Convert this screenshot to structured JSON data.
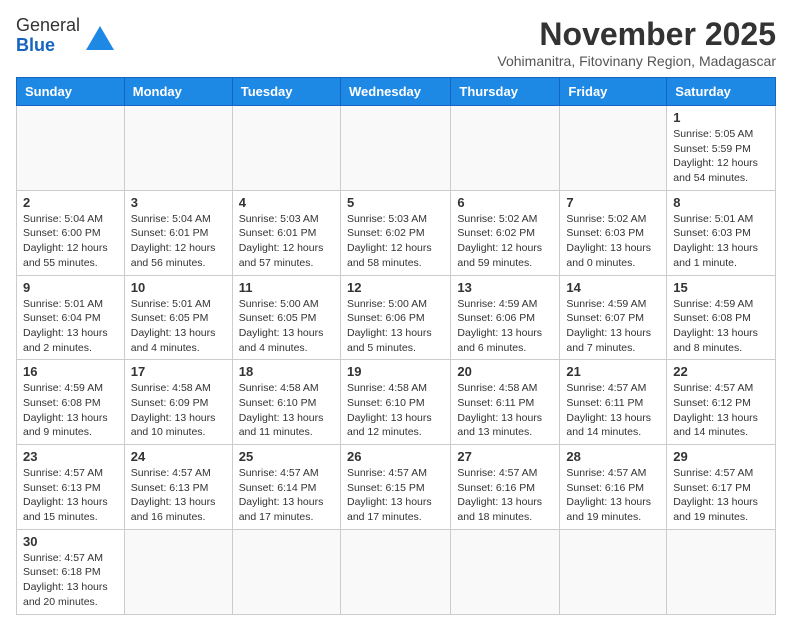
{
  "logo": {
    "general": "General",
    "blue": "Blue"
  },
  "title": "November 2025",
  "location": "Vohimanitra, Fitovinany Region, Madagascar",
  "days_header": [
    "Sunday",
    "Monday",
    "Tuesday",
    "Wednesday",
    "Thursday",
    "Friday",
    "Saturday"
  ],
  "weeks": [
    [
      {
        "day": "",
        "info": ""
      },
      {
        "day": "",
        "info": ""
      },
      {
        "day": "",
        "info": ""
      },
      {
        "day": "",
        "info": ""
      },
      {
        "day": "",
        "info": ""
      },
      {
        "day": "",
        "info": ""
      },
      {
        "day": "1",
        "info": "Sunrise: 5:05 AM\nSunset: 5:59 PM\nDaylight: 12 hours and 54 minutes."
      }
    ],
    [
      {
        "day": "2",
        "info": "Sunrise: 5:04 AM\nSunset: 6:00 PM\nDaylight: 12 hours and 55 minutes."
      },
      {
        "day": "3",
        "info": "Sunrise: 5:04 AM\nSunset: 6:01 PM\nDaylight: 12 hours and 56 minutes."
      },
      {
        "day": "4",
        "info": "Sunrise: 5:03 AM\nSunset: 6:01 PM\nDaylight: 12 hours and 57 minutes."
      },
      {
        "day": "5",
        "info": "Sunrise: 5:03 AM\nSunset: 6:02 PM\nDaylight: 12 hours and 58 minutes."
      },
      {
        "day": "6",
        "info": "Sunrise: 5:02 AM\nSunset: 6:02 PM\nDaylight: 12 hours and 59 minutes."
      },
      {
        "day": "7",
        "info": "Sunrise: 5:02 AM\nSunset: 6:03 PM\nDaylight: 13 hours and 0 minutes."
      },
      {
        "day": "8",
        "info": "Sunrise: 5:01 AM\nSunset: 6:03 PM\nDaylight: 13 hours and 1 minute."
      }
    ],
    [
      {
        "day": "9",
        "info": "Sunrise: 5:01 AM\nSunset: 6:04 PM\nDaylight: 13 hours and 2 minutes."
      },
      {
        "day": "10",
        "info": "Sunrise: 5:01 AM\nSunset: 6:05 PM\nDaylight: 13 hours and 4 minutes."
      },
      {
        "day": "11",
        "info": "Sunrise: 5:00 AM\nSunset: 6:05 PM\nDaylight: 13 hours and 4 minutes."
      },
      {
        "day": "12",
        "info": "Sunrise: 5:00 AM\nSunset: 6:06 PM\nDaylight: 13 hours and 5 minutes."
      },
      {
        "day": "13",
        "info": "Sunrise: 4:59 AM\nSunset: 6:06 PM\nDaylight: 13 hours and 6 minutes."
      },
      {
        "day": "14",
        "info": "Sunrise: 4:59 AM\nSunset: 6:07 PM\nDaylight: 13 hours and 7 minutes."
      },
      {
        "day": "15",
        "info": "Sunrise: 4:59 AM\nSunset: 6:08 PM\nDaylight: 13 hours and 8 minutes."
      }
    ],
    [
      {
        "day": "16",
        "info": "Sunrise: 4:59 AM\nSunset: 6:08 PM\nDaylight: 13 hours and 9 minutes."
      },
      {
        "day": "17",
        "info": "Sunrise: 4:58 AM\nSunset: 6:09 PM\nDaylight: 13 hours and 10 minutes."
      },
      {
        "day": "18",
        "info": "Sunrise: 4:58 AM\nSunset: 6:10 PM\nDaylight: 13 hours and 11 minutes."
      },
      {
        "day": "19",
        "info": "Sunrise: 4:58 AM\nSunset: 6:10 PM\nDaylight: 13 hours and 12 minutes."
      },
      {
        "day": "20",
        "info": "Sunrise: 4:58 AM\nSunset: 6:11 PM\nDaylight: 13 hours and 13 minutes."
      },
      {
        "day": "21",
        "info": "Sunrise: 4:57 AM\nSunset: 6:11 PM\nDaylight: 13 hours and 14 minutes."
      },
      {
        "day": "22",
        "info": "Sunrise: 4:57 AM\nSunset: 6:12 PM\nDaylight: 13 hours and 14 minutes."
      }
    ],
    [
      {
        "day": "23",
        "info": "Sunrise: 4:57 AM\nSunset: 6:13 PM\nDaylight: 13 hours and 15 minutes."
      },
      {
        "day": "24",
        "info": "Sunrise: 4:57 AM\nSunset: 6:13 PM\nDaylight: 13 hours and 16 minutes."
      },
      {
        "day": "25",
        "info": "Sunrise: 4:57 AM\nSunset: 6:14 PM\nDaylight: 13 hours and 17 minutes."
      },
      {
        "day": "26",
        "info": "Sunrise: 4:57 AM\nSunset: 6:15 PM\nDaylight: 13 hours and 17 minutes."
      },
      {
        "day": "27",
        "info": "Sunrise: 4:57 AM\nSunset: 6:16 PM\nDaylight: 13 hours and 18 minutes."
      },
      {
        "day": "28",
        "info": "Sunrise: 4:57 AM\nSunset: 6:16 PM\nDaylight: 13 hours and 19 minutes."
      },
      {
        "day": "29",
        "info": "Sunrise: 4:57 AM\nSunset: 6:17 PM\nDaylight: 13 hours and 19 minutes."
      }
    ],
    [
      {
        "day": "30",
        "info": "Sunrise: 4:57 AM\nSunset: 6:18 PM\nDaylight: 13 hours and 20 minutes."
      },
      {
        "day": "",
        "info": ""
      },
      {
        "day": "",
        "info": ""
      },
      {
        "day": "",
        "info": ""
      },
      {
        "day": "",
        "info": ""
      },
      {
        "day": "",
        "info": ""
      },
      {
        "day": "",
        "info": ""
      }
    ]
  ]
}
